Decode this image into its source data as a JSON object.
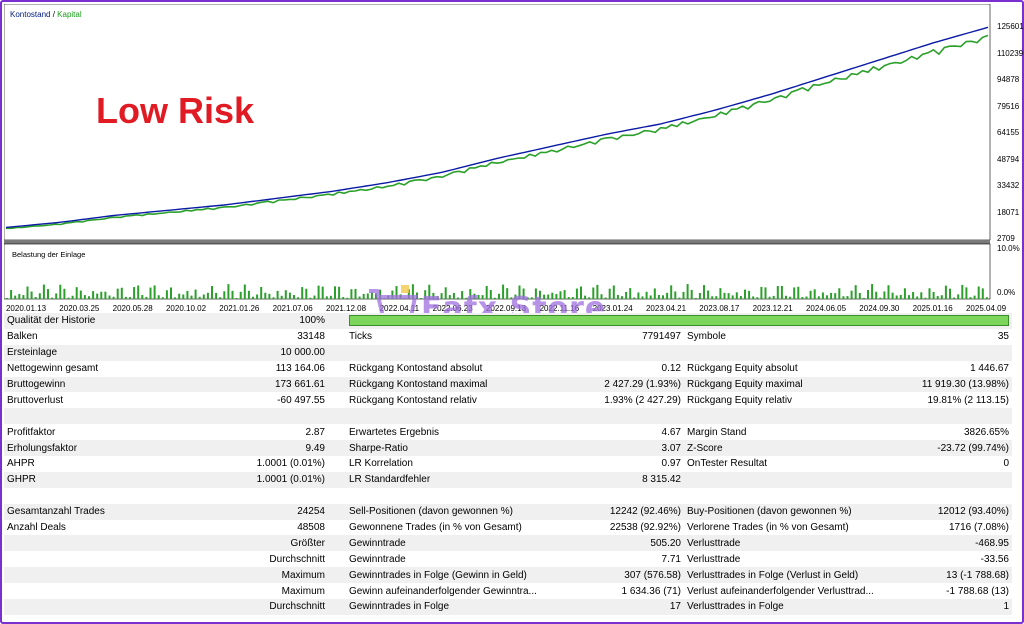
{
  "legend": {
    "balance": "Kontostand",
    "separator": " / ",
    "equity": "Kapital"
  },
  "overlay_title": "Low Risk",
  "sub_chart_label": "Belastung der Einlage",
  "watermark": "Eafx Store",
  "colors": {
    "balance": "#0b1ba6",
    "equity": "#2aa02a",
    "title": "#e01b24",
    "frame": "#7a2fd0"
  },
  "y_axis": [
    "125601",
    "110239",
    "94878",
    "79516",
    "64155",
    "48794",
    "33432",
    "18071",
    "2709"
  ],
  "sub_y_axis": [
    "10.0%",
    "0.0%"
  ],
  "x_axis": [
    "2020.01.13",
    "2020.03.25",
    "2020.05.28",
    "2020.10.02",
    "2021.01.26",
    "2021.07.06",
    "2021.12.08",
    "2022.04.11",
    "2022.06.23",
    "2022.09.13",
    "2022.11.16",
    "2023.01.24",
    "2023.04.21",
    "2023.08.17",
    "2023.12.21",
    "2024.06.05",
    "2024.09.30",
    "2025.01.16",
    "2025.04.09"
  ],
  "chart_data": {
    "type": "line",
    "y_range": [
      2709,
      125601
    ],
    "series": [
      {
        "name": "Kontostand",
        "values": [
          10000,
          13000,
          17000,
          20000,
          23000,
          27000,
          31000,
          36000,
          42000,
          50000,
          57000,
          64000,
          70000,
          78000,
          87000,
          97000,
          107000,
          117000,
          126000
        ]
      },
      {
        "name": "Kapital",
        "values": [
          9500,
          12200,
          16200,
          19100,
          22000,
          26000,
          30000,
          34500,
          40500,
          48500,
          55000,
          62000,
          68000,
          76000,
          85000,
          95000,
          104000,
          113000,
          122000
        ]
      }
    ]
  },
  "stats": {
    "rows": [
      {
        "c1": "Qualität der Historie",
        "c2": "100%",
        "c3": "",
        "c4": "",
        "c5": "",
        "c6": ""
      },
      {
        "c1": "Balken",
        "c2": "33148",
        "c3": "Ticks",
        "c4": "7791497",
        "c5": "Symbole",
        "c6": "35"
      },
      {
        "c1": "Ersteinlage",
        "c2": "10 000.00",
        "c3": "",
        "c4": "",
        "c5": "",
        "c6": ""
      },
      {
        "c1": "Nettogewinn gesamt",
        "c2": "113 164.06",
        "c3": "Rückgang Kontostand absolut",
        "c4": "0.12",
        "c5": "Rückgang Equity absolut",
        "c6": "1 446.67"
      },
      {
        "c1": "Bruttogewinn",
        "c2": "173 661.61",
        "c3": "Rückgang Kontostand maximal",
        "c4": "2 427.29 (1.93%)",
        "c5": "Rückgang Equity maximal",
        "c6": "11 919.30 (13.98%)"
      },
      {
        "c1": "Bruttoverlust",
        "c2": "-60 497.55",
        "c3": "Rückgang Kontostand relativ",
        "c4": "1.93% (2 427.29)",
        "c5": "Rückgang Equity relativ",
        "c6": "19.81% (2 113.15)"
      },
      {
        "c1": "",
        "c2": "",
        "c3": "",
        "c4": "",
        "c5": "",
        "c6": ""
      },
      {
        "c1": "Profitfaktor",
        "c2": "2.87",
        "c3": "Erwartetes Ergebnis",
        "c4": "4.67",
        "c5": "Margin Stand",
        "c6": "3826.65%"
      },
      {
        "c1": "Erholungsfaktor",
        "c2": "9.49",
        "c3": "Sharpe-Ratio",
        "c4": "3.07",
        "c5": "Z-Score",
        "c6": "-23.72 (99.74%)"
      },
      {
        "c1": "AHPR",
        "c2": "1.0001 (0.01%)",
        "c3": "LR Korrelation",
        "c4": "0.97",
        "c5": "OnTester Resultat",
        "c6": "0"
      },
      {
        "c1": "GHPR",
        "c2": "1.0001 (0.01%)",
        "c3": "LR Standardfehler",
        "c4": "8 315.42",
        "c5": "",
        "c6": ""
      },
      {
        "c1": "",
        "c2": "",
        "c3": "",
        "c4": "",
        "c5": "",
        "c6": ""
      },
      {
        "c1": "Gesamtanzahl Trades",
        "c2": "24254",
        "c3": "Sell-Positionen (davon gewonnen %)",
        "c4": "12242 (92.46%)",
        "c5": "Buy-Positionen (davon gewonnen %)",
        "c6": "12012 (93.40%)"
      },
      {
        "c1": "Anzahl Deals",
        "c2": "48508",
        "c3": "Gewonnene Trades (in % von Gesamt)",
        "c4": "22538 (92.92%)",
        "c5": "Verlorene Trades (in % von Gesamt)",
        "c6": "1716 (7.08%)"
      },
      {
        "c1": "",
        "c2": "Größter",
        "c3": "Gewinntrade",
        "c4": "505.20",
        "c5": "Verlusttrade",
        "c6": "-468.95"
      },
      {
        "c1": "",
        "c2": "Durchschnitt",
        "c3": "Gewinntrade",
        "c4": "7.71",
        "c5": "Verlusttrade",
        "c6": "-33.56"
      },
      {
        "c1": "",
        "c2": "Maximum",
        "c3": "Gewinntrades in Folge (Gewinn in Geld)",
        "c4": "307 (576.58)",
        "c5": "Verlusttrades in Folge (Verlust in Geld)",
        "c6": "13 (-1 788.68)"
      },
      {
        "c1": "",
        "c2": "Maximum",
        "c3": "Gewinn aufeinanderfolgender Gewinntra...",
        "c4": "1 634.36 (71)",
        "c5": "Verlust aufeinanderfolgender Verlusttrad...",
        "c6": "-1 788.68 (13)"
      },
      {
        "c1": "",
        "c2": "Durchschnitt",
        "c3": "Gewinntrades in Folge",
        "c4": "17",
        "c5": "Verlusttrades in Folge",
        "c6": "1"
      }
    ]
  }
}
